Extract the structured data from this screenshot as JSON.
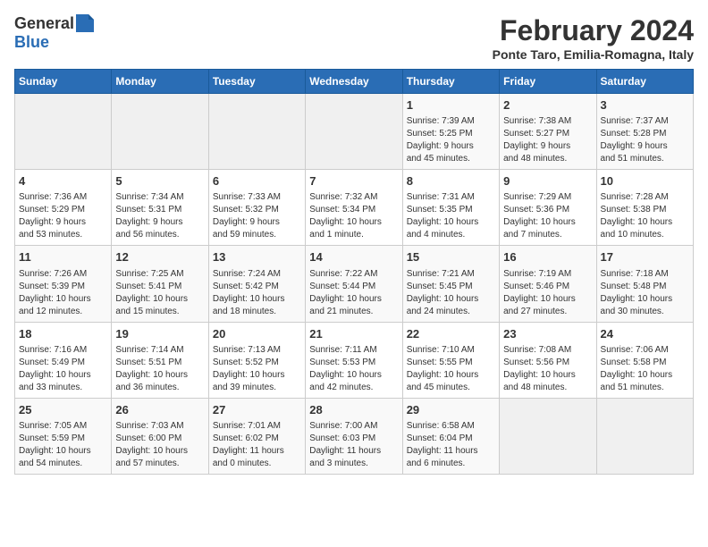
{
  "header": {
    "logo_general": "General",
    "logo_blue": "Blue",
    "month_year": "February 2024",
    "location": "Ponte Taro, Emilia-Romagna, Italy"
  },
  "days_of_week": [
    "Sunday",
    "Monday",
    "Tuesday",
    "Wednesday",
    "Thursday",
    "Friday",
    "Saturday"
  ],
  "weeks": [
    [
      {
        "day": "",
        "info": ""
      },
      {
        "day": "",
        "info": ""
      },
      {
        "day": "",
        "info": ""
      },
      {
        "day": "",
        "info": ""
      },
      {
        "day": "1",
        "info": "Sunrise: 7:39 AM\nSunset: 5:25 PM\nDaylight: 9 hours\nand 45 minutes."
      },
      {
        "day": "2",
        "info": "Sunrise: 7:38 AM\nSunset: 5:27 PM\nDaylight: 9 hours\nand 48 minutes."
      },
      {
        "day": "3",
        "info": "Sunrise: 7:37 AM\nSunset: 5:28 PM\nDaylight: 9 hours\nand 51 minutes."
      }
    ],
    [
      {
        "day": "4",
        "info": "Sunrise: 7:36 AM\nSunset: 5:29 PM\nDaylight: 9 hours\nand 53 minutes."
      },
      {
        "day": "5",
        "info": "Sunrise: 7:34 AM\nSunset: 5:31 PM\nDaylight: 9 hours\nand 56 minutes."
      },
      {
        "day": "6",
        "info": "Sunrise: 7:33 AM\nSunset: 5:32 PM\nDaylight: 9 hours\nand 59 minutes."
      },
      {
        "day": "7",
        "info": "Sunrise: 7:32 AM\nSunset: 5:34 PM\nDaylight: 10 hours\nand 1 minute."
      },
      {
        "day": "8",
        "info": "Sunrise: 7:31 AM\nSunset: 5:35 PM\nDaylight: 10 hours\nand 4 minutes."
      },
      {
        "day": "9",
        "info": "Sunrise: 7:29 AM\nSunset: 5:36 PM\nDaylight: 10 hours\nand 7 minutes."
      },
      {
        "day": "10",
        "info": "Sunrise: 7:28 AM\nSunset: 5:38 PM\nDaylight: 10 hours\nand 10 minutes."
      }
    ],
    [
      {
        "day": "11",
        "info": "Sunrise: 7:26 AM\nSunset: 5:39 PM\nDaylight: 10 hours\nand 12 minutes."
      },
      {
        "day": "12",
        "info": "Sunrise: 7:25 AM\nSunset: 5:41 PM\nDaylight: 10 hours\nand 15 minutes."
      },
      {
        "day": "13",
        "info": "Sunrise: 7:24 AM\nSunset: 5:42 PM\nDaylight: 10 hours\nand 18 minutes."
      },
      {
        "day": "14",
        "info": "Sunrise: 7:22 AM\nSunset: 5:44 PM\nDaylight: 10 hours\nand 21 minutes."
      },
      {
        "day": "15",
        "info": "Sunrise: 7:21 AM\nSunset: 5:45 PM\nDaylight: 10 hours\nand 24 minutes."
      },
      {
        "day": "16",
        "info": "Sunrise: 7:19 AM\nSunset: 5:46 PM\nDaylight: 10 hours\nand 27 minutes."
      },
      {
        "day": "17",
        "info": "Sunrise: 7:18 AM\nSunset: 5:48 PM\nDaylight: 10 hours\nand 30 minutes."
      }
    ],
    [
      {
        "day": "18",
        "info": "Sunrise: 7:16 AM\nSunset: 5:49 PM\nDaylight: 10 hours\nand 33 minutes."
      },
      {
        "day": "19",
        "info": "Sunrise: 7:14 AM\nSunset: 5:51 PM\nDaylight: 10 hours\nand 36 minutes."
      },
      {
        "day": "20",
        "info": "Sunrise: 7:13 AM\nSunset: 5:52 PM\nDaylight: 10 hours\nand 39 minutes."
      },
      {
        "day": "21",
        "info": "Sunrise: 7:11 AM\nSunset: 5:53 PM\nDaylight: 10 hours\nand 42 minutes."
      },
      {
        "day": "22",
        "info": "Sunrise: 7:10 AM\nSunset: 5:55 PM\nDaylight: 10 hours\nand 45 minutes."
      },
      {
        "day": "23",
        "info": "Sunrise: 7:08 AM\nSunset: 5:56 PM\nDaylight: 10 hours\nand 48 minutes."
      },
      {
        "day": "24",
        "info": "Sunrise: 7:06 AM\nSunset: 5:58 PM\nDaylight: 10 hours\nand 51 minutes."
      }
    ],
    [
      {
        "day": "25",
        "info": "Sunrise: 7:05 AM\nSunset: 5:59 PM\nDaylight: 10 hours\nand 54 minutes."
      },
      {
        "day": "26",
        "info": "Sunrise: 7:03 AM\nSunset: 6:00 PM\nDaylight: 10 hours\nand 57 minutes."
      },
      {
        "day": "27",
        "info": "Sunrise: 7:01 AM\nSunset: 6:02 PM\nDaylight: 11 hours\nand 0 minutes."
      },
      {
        "day": "28",
        "info": "Sunrise: 7:00 AM\nSunset: 6:03 PM\nDaylight: 11 hours\nand 3 minutes."
      },
      {
        "day": "29",
        "info": "Sunrise: 6:58 AM\nSunset: 6:04 PM\nDaylight: 11 hours\nand 6 minutes."
      },
      {
        "day": "",
        "info": ""
      },
      {
        "day": "",
        "info": ""
      }
    ]
  ]
}
